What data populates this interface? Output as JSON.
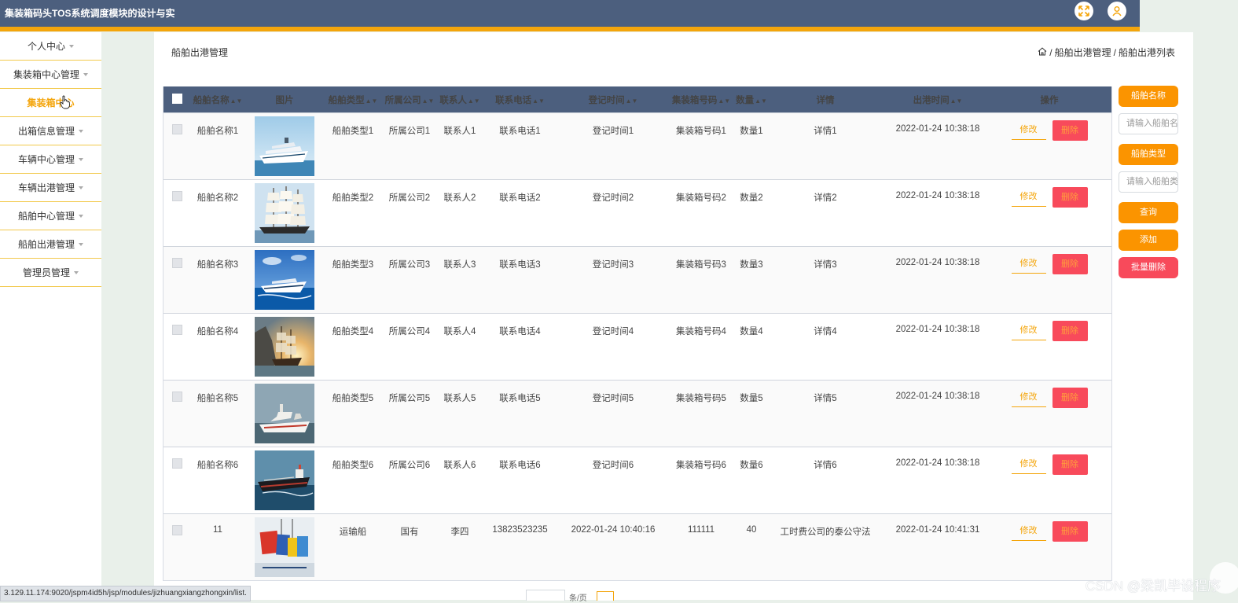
{
  "header": {
    "title": "集装箱码头TOS系统调度模块的设计与实",
    "colors": {
      "bar": "#4c5f7e",
      "accent": "#f4a50b"
    },
    "icons": [
      "fullscreen-icon",
      "user-icon"
    ]
  },
  "sidebar": {
    "items": [
      {
        "label": "个人中心",
        "has_caret": true
      },
      {
        "label": "集装箱中心管理",
        "has_caret": true
      },
      {
        "label": "集装箱中心",
        "has_caret": false,
        "active": true
      },
      {
        "label": "出箱信息管理",
        "has_caret": true
      },
      {
        "label": "车辆中心管理",
        "has_caret": true
      },
      {
        "label": "车辆出港管理",
        "has_caret": true
      },
      {
        "label": "船舶中心管理",
        "has_caret": true
      },
      {
        "label": "船舶出港管理",
        "has_caret": true
      },
      {
        "label": "管理员管理",
        "has_caret": true
      }
    ]
  },
  "page": {
    "heading": "船舶出港管理",
    "breadcrumb": {
      "sep": "/",
      "level1": "船舶出港管理",
      "level2": "船舶出港列表"
    }
  },
  "table": {
    "columns": [
      "船舶名称",
      "图片",
      "船舶类型",
      "所属公司",
      "联系人",
      "联系电话",
      "登记时间",
      "集装箱号码",
      "数量",
      "详情",
      "出港时间",
      "操作"
    ],
    "rows": [
      {
        "name": "船舶名称1",
        "image": "cruise-ship-photo",
        "type": "船舶类型1",
        "company": "所属公司1",
        "contact": "联系人1",
        "phone": "联系电话1",
        "reg_time": "登记时间1",
        "box_no": "集装箱号码1",
        "qty": "数量1",
        "detail": "详情1",
        "out_time": "2022-01-24 10:38:18"
      },
      {
        "name": "船舶名称2",
        "image": "tall-sailing-ship-photo",
        "type": "船舶类型2",
        "company": "所属公司2",
        "contact": "联系人2",
        "phone": "联系电话2",
        "reg_time": "登记时间2",
        "box_no": "集装箱号码2",
        "qty": "数量2",
        "detail": "详情2",
        "out_time": "2022-01-24 10:38:18"
      },
      {
        "name": "船舶名称3",
        "image": "yacht-photo",
        "type": "船舶类型3",
        "company": "所属公司3",
        "contact": "联系人3",
        "phone": "联系电话3",
        "reg_time": "登记时间3",
        "box_no": "集装箱号码3",
        "qty": "数量3",
        "detail": "详情3",
        "out_time": "2022-01-24 10:38:18"
      },
      {
        "name": "船舶名称4",
        "image": "galleon-sunset-photo",
        "type": "船舶类型4",
        "company": "所属公司4",
        "contact": "联系人4",
        "phone": "联系电话4",
        "reg_time": "登记时间4",
        "box_no": "集装箱号码4",
        "qty": "数量4",
        "detail": "详情4",
        "out_time": "2022-01-24 10:38:18"
      },
      {
        "name": "船舶名称5",
        "image": "research-vessel-photo",
        "type": "船舶类型5",
        "company": "所属公司5",
        "contact": "联系人5",
        "phone": "联系电话5",
        "reg_time": "登记时间5",
        "box_no": "集装箱号码5",
        "qty": "数量5",
        "detail": "详情5",
        "out_time": "2022-01-24 10:38:18"
      },
      {
        "name": "船舶名称6",
        "image": "tanker-photo",
        "type": "船舶类型6",
        "company": "所属公司6",
        "contact": "联系人6",
        "phone": "联系电话6",
        "reg_time": "登记时间6",
        "box_no": "集装箱号码6",
        "qty": "数量6",
        "detail": "详情6",
        "out_time": "2022-01-24 10:38:18"
      },
      {
        "name": "11",
        "image": "shipping-containers-photo",
        "type": "运输船",
        "company": "国有",
        "contact": "李四",
        "phone": "13823523235",
        "reg_time": "2022-01-24 10:40:16",
        "box_no": "111111",
        "qty": "40",
        "detail": "工时费公司的泰公守法",
        "out_time": "2022-01-24 10:41:31"
      }
    ],
    "edit_label": "修改",
    "delete_label": "删除",
    "colors": {
      "header": "#4c5f7e",
      "edit": "#f4a50b",
      "delete": "#f84a5b"
    }
  },
  "search_panel": {
    "name_button": "船舶名称",
    "name_placeholder": "请输入船舶名称",
    "type_button": "船舶类型",
    "type_placeholder": "请输入船舶类型",
    "query_button": "查询",
    "add_button": "添加",
    "batch_delete_button": "批量删除",
    "colors": {
      "primary": "#fb9400",
      "danger": "#f84a5b"
    }
  },
  "footer": {
    "status_url": "3.129.11.174:9020/jspm4id5h/jsp/modules/jizhuangxiangzhongxin/list.",
    "pager_text": "条/页",
    "watermark": "CSDN @梁凯毕设程序"
  }
}
